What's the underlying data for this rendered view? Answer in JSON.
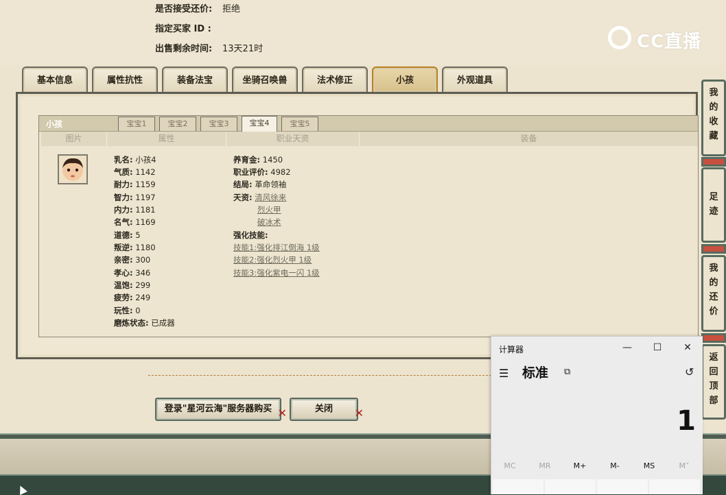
{
  "info": {
    "accept_counter_label": "是否接受还价:",
    "accept_counter_value": "拒绝",
    "buyer_id_label": "指定买家 ID :",
    "buyer_id_value": "",
    "time_left_label": "出售剩余时间:",
    "time_left_value": "13天21时"
  },
  "logo": {
    "text": "CC直播"
  },
  "tabs": [
    {
      "label": "基本信息",
      "active": false
    },
    {
      "label": "属性抗性",
      "active": false
    },
    {
      "label": "装备法宝",
      "active": false
    },
    {
      "label": "坐骑召唤兽",
      "active": false
    },
    {
      "label": "法术修正",
      "active": false
    },
    {
      "label": "小孩",
      "active": true
    },
    {
      "label": "外观道具",
      "active": false
    }
  ],
  "child_panel": {
    "title": "小孩",
    "subtabs": [
      {
        "label": "宝宝1",
        "active": false
      },
      {
        "label": "宝宝2",
        "active": false
      },
      {
        "label": "宝宝3",
        "active": false
      },
      {
        "label": "宝宝4",
        "active": true
      },
      {
        "label": "宝宝5",
        "active": false
      }
    ],
    "columns": [
      "图片",
      "属性",
      "职业天资",
      "装备"
    ],
    "attributes": [
      {
        "k": "乳名:",
        "v": "小孩4"
      },
      {
        "k": "气质:",
        "v": "1142"
      },
      {
        "k": "耐力:",
        "v": "1159"
      },
      {
        "k": "智力:",
        "v": "1197"
      },
      {
        "k": "内力:",
        "v": "1181"
      },
      {
        "k": "名气:",
        "v": "1169"
      },
      {
        "k": "道德:",
        "v": "5"
      },
      {
        "k": "叛逆:",
        "v": "1180"
      },
      {
        "k": "亲密:",
        "v": "300"
      },
      {
        "k": "孝心:",
        "v": "346"
      },
      {
        "k": "温饱:",
        "v": "299"
      },
      {
        "k": "疲劳:",
        "v": "249"
      },
      {
        "k": "玩性:",
        "v": "0"
      },
      {
        "k": "磨炼状态:",
        "v": "已成器"
      }
    ],
    "profession": {
      "nurture_label": "养育金:",
      "nurture_value": "1450",
      "rating_label": "职业评价:",
      "rating_value": "4982",
      "ending_label": "结局:",
      "ending_value": "革命领袖",
      "talent_label": "天资:",
      "talents": [
        "清风徐来",
        "烈火甲",
        "破冰术"
      ],
      "skills_label": "强化技能:",
      "skills": [
        "技能1:强化排江倒海 1级",
        "技能2:强化烈火甲 1级",
        "技能3:强化紫电一闪 1级"
      ]
    }
  },
  "buttons": {
    "login_buy": "登录\"星河云海\"服务器购买",
    "close": "关闭"
  },
  "sidebar": [
    {
      "label": "我的收藏"
    },
    {
      "label": "足迹"
    },
    {
      "label": "我的还价"
    },
    {
      "label": "返回顶部"
    }
  ],
  "calculator": {
    "title": "计算器",
    "mode": "标准",
    "display": "1",
    "memory_keys": [
      "MC",
      "MR",
      "M+",
      "M-",
      "MS",
      "M˅"
    ],
    "icons": [
      "hamburger-icon",
      "keep-on-top-icon",
      "history-icon",
      "minimize-icon",
      "maximize-icon",
      "close-icon"
    ]
  }
}
